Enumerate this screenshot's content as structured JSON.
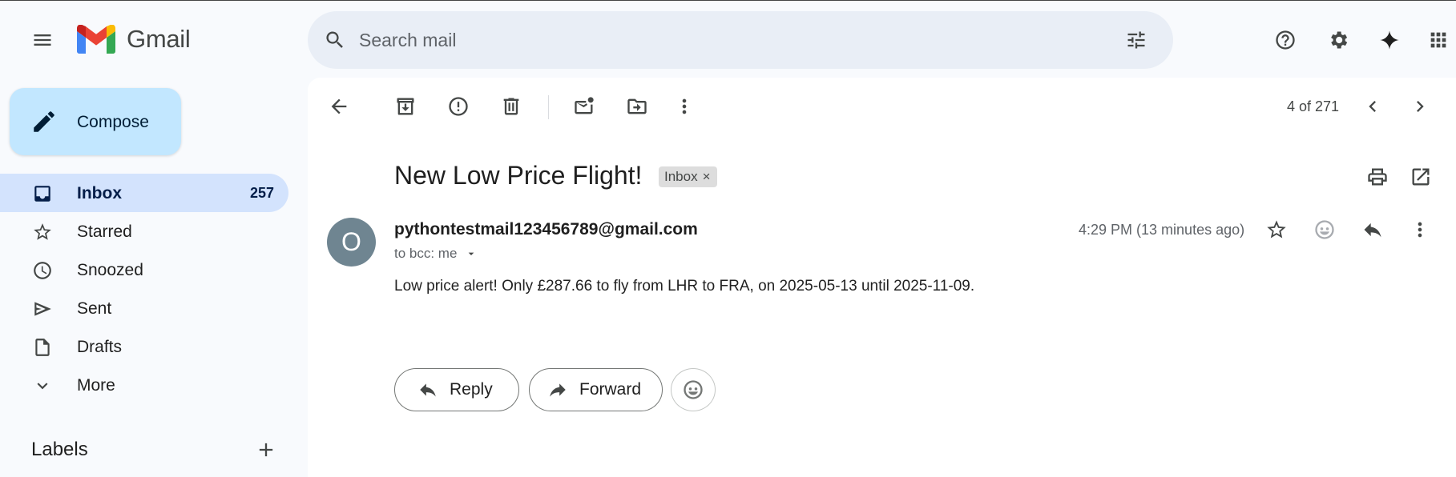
{
  "app": {
    "name": "Gmail",
    "logo_colors": [
      "#ea4335",
      "#4285f4",
      "#34a853",
      "#fbbc04",
      "#c5221f"
    ]
  },
  "header": {
    "search_placeholder": "Search mail",
    "icons": [
      "main-menu-icon",
      "search-icon",
      "search-options-icon",
      "help-icon",
      "settings-icon",
      "gemini-icon",
      "apps-grid-icon"
    ]
  },
  "sidebar": {
    "compose_label": "Compose",
    "items": [
      {
        "label": "Inbox",
        "count": "257",
        "icon": "inbox-icon",
        "active": true
      },
      {
        "label": "Starred",
        "count": "",
        "icon": "star-icon",
        "active": false
      },
      {
        "label": "Snoozed",
        "count": "",
        "icon": "clock-icon",
        "active": false
      },
      {
        "label": "Sent",
        "count": "",
        "icon": "send-icon",
        "active": false
      },
      {
        "label": "Drafts",
        "count": "",
        "icon": "draft-icon",
        "active": false
      },
      {
        "label": "More",
        "count": "",
        "icon": "chevron-down-icon",
        "active": false
      }
    ],
    "labels_title": "Labels"
  },
  "toolbar": {
    "page_count": "4 of 271",
    "icons": [
      "back-arrow-icon",
      "archive-icon",
      "report-spam-icon",
      "delete-icon",
      "mark-unread-icon",
      "move-to-icon",
      "more-vert-icon",
      "newer-chevron-icon",
      "older-chevron-icon"
    ]
  },
  "email": {
    "subject": "New Low Price Flight!",
    "label_chip": "Inbox",
    "label_chip_close": "×",
    "sender_initial": "O",
    "sender": "pythontestmail123456789@gmail.com",
    "recipients": "to bcc: me",
    "timestamp": "4:29 PM (13 minutes ago)",
    "body": "Low price alert! Only £287.66 to fly from LHR to FRA, on 2025-05-13 until 2025-11-09.",
    "avatar_color": "#6f8591"
  },
  "actions": {
    "reply_label": "Reply",
    "forward_label": "Forward"
  },
  "colors": {
    "accent_light": "#c2e7ff",
    "active_nav": "#d3e3fd",
    "search_bg": "#e9eef6",
    "page_bg": "#f8fafd"
  }
}
